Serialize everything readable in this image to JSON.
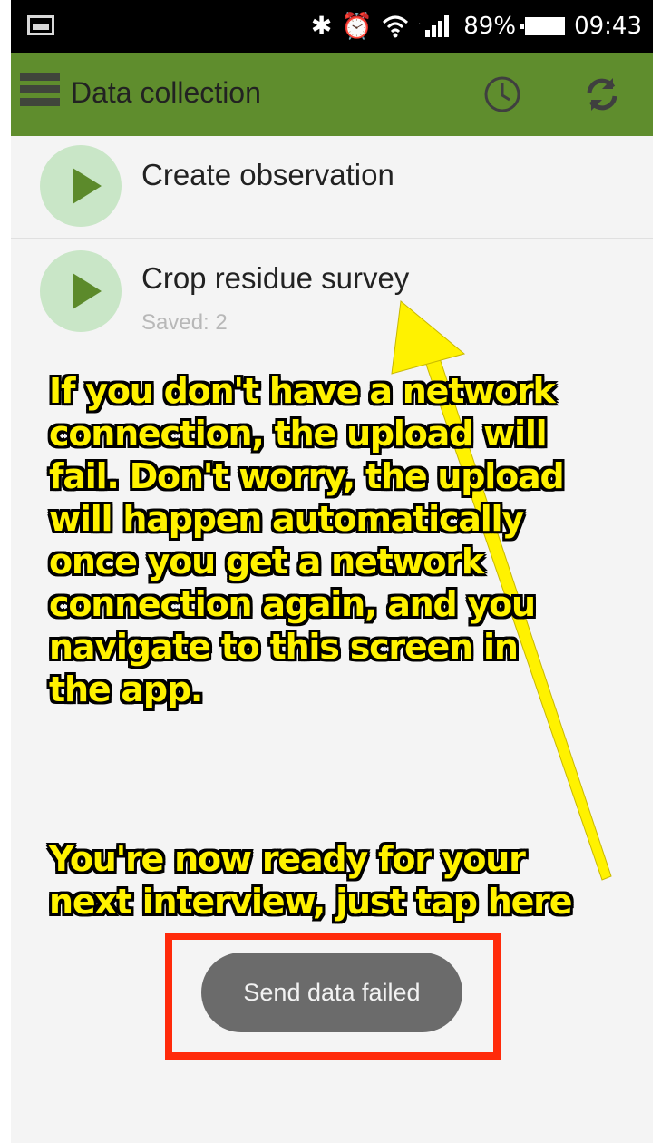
{
  "status_bar": {
    "battery": "89%",
    "time": "09:43",
    "icons": [
      "gallery-icon",
      "bluetooth-icon",
      "alarm-icon",
      "wifi-icon",
      "signal-icon",
      "battery-icon"
    ]
  },
  "app_bar": {
    "title": "Data collection",
    "color": "#5f8d2d",
    "icons": [
      "menu-icon",
      "history-icon",
      "sync-icon"
    ]
  },
  "forms": [
    {
      "title": "Create observation",
      "subtitle": ""
    },
    {
      "title": "Crop residue survey",
      "subtitle": "Saved: 2"
    }
  ],
  "annotation": {
    "text_1": "If you don't have a network\nconnection, the upload will\nfail. Don't worry, the upload\nwill happen automatically\nonce you get a network\nconnection again, and you\nnavigate to this screen in\nthe app.",
    "text_2": "You're now ready for your\nnext interview, just tap here",
    "text_color": "#fff200",
    "highlight_color": "#ff2a0a"
  },
  "toast": {
    "message": "Send data failed"
  }
}
